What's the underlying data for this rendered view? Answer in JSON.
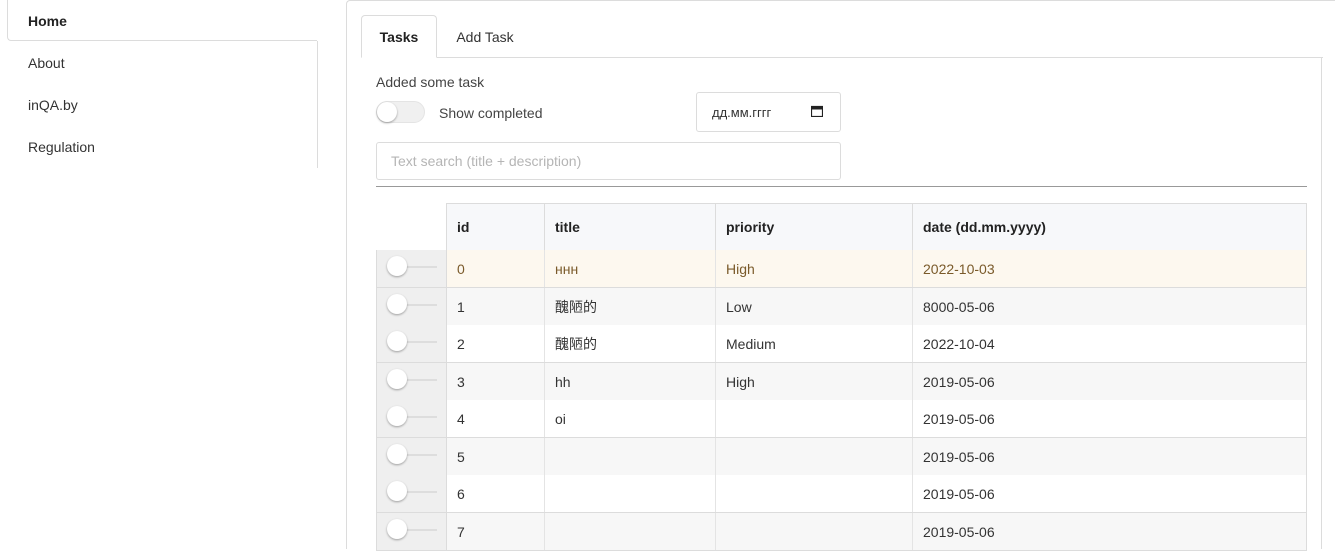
{
  "sidebar": {
    "items": [
      {
        "label": "Home",
        "active": true
      },
      {
        "label": "About"
      },
      {
        "label": "inQA.by"
      },
      {
        "label": "Regulation"
      }
    ]
  },
  "tabs": [
    {
      "label": "Tasks",
      "active": true
    },
    {
      "label": "Add Task"
    }
  ],
  "status": "Added some task",
  "filters": {
    "show_completed_label": "Show completed",
    "show_completed": false,
    "date_placeholder": "дд.мм.гггг",
    "search_placeholder": "Text search (title + description)"
  },
  "table": {
    "columns": [
      "id",
      "title",
      "priority",
      "date (dd.mm.yyyy)"
    ],
    "rows": [
      {
        "id": "0",
        "title": "ннн",
        "priority": "High",
        "date": "2022-10-03"
      },
      {
        "id": "1",
        "title": "醜陋的",
        "priority": "Low",
        "date": "8000-05-06"
      },
      {
        "id": "2",
        "title": "醜陋的",
        "priority": "Medium",
        "date": "2022-10-04"
      },
      {
        "id": "3",
        "title": "hh",
        "priority": "High",
        "date": "2019-05-06"
      },
      {
        "id": "4",
        "title": "oi",
        "priority": "",
        "date": "2019-05-06"
      },
      {
        "id": "5",
        "title": "",
        "priority": "",
        "date": "2019-05-06"
      },
      {
        "id": "6",
        "title": "",
        "priority": "",
        "date": "2019-05-06"
      },
      {
        "id": "7",
        "title": "",
        "priority": "",
        "date": "2019-05-06"
      }
    ]
  },
  "colors": {
    "border": "#dcdcdc",
    "header_bg": "#f7f8fa",
    "highlight_row_bg": "#fdf8ef",
    "highlight_row_text": "#7a5a2a"
  }
}
